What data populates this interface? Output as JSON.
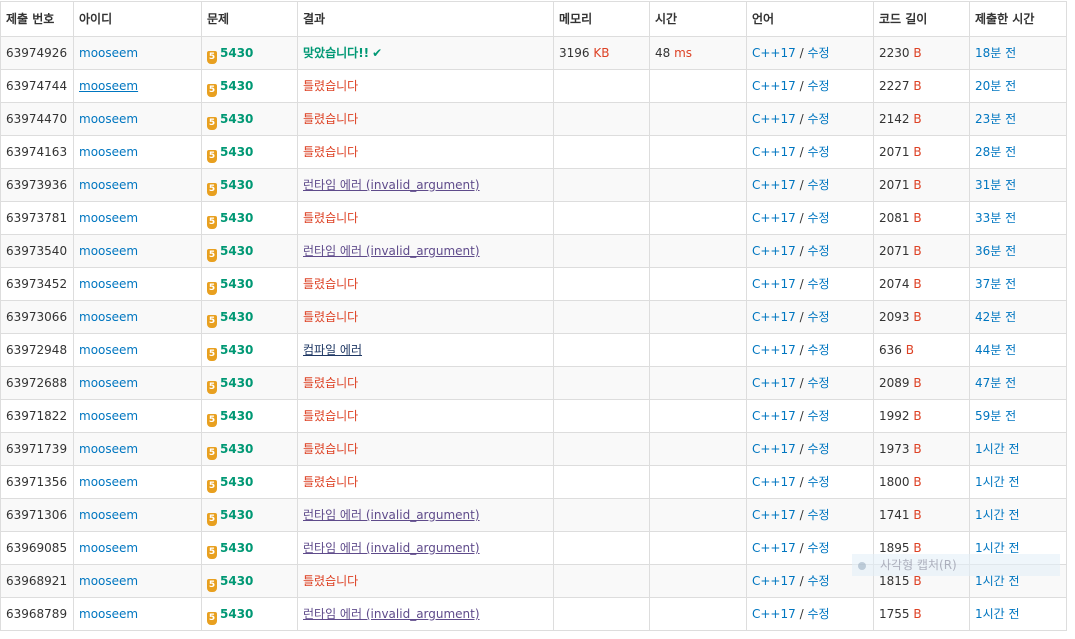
{
  "headers": [
    "제출 번호",
    "아이디",
    "문제",
    "결과",
    "메모리",
    "시간",
    "언어",
    "코드 길이",
    "제출한 시간"
  ],
  "tier_label": "5",
  "lang_sep": " / ",
  "overlay_text": "사각형 캡처(R)",
  "rows": [
    {
      "id": "63974926",
      "user": "mooseem",
      "problem": "5430",
      "result": "맞았습니다!!",
      "result_type": "ac",
      "memory": "3196",
      "memory_unit": "KB",
      "time": "48",
      "time_unit": "ms",
      "lang": "C++17",
      "edit": "수정",
      "length": "2230",
      "length_unit": "B",
      "submitted": "18분 전"
    },
    {
      "id": "63974744",
      "user": "mooseem",
      "problem": "5430",
      "result": "틀렸습니다",
      "result_type": "wa",
      "memory": "",
      "memory_unit": "",
      "time": "",
      "time_unit": "",
      "lang": "C++17",
      "edit": "수정",
      "length": "2227",
      "length_unit": "B",
      "submitted": "20분 전",
      "user_underline": true
    },
    {
      "id": "63974470",
      "user": "mooseem",
      "problem": "5430",
      "result": "틀렸습니다",
      "result_type": "wa",
      "memory": "",
      "memory_unit": "",
      "time": "",
      "time_unit": "",
      "lang": "C++17",
      "edit": "수정",
      "length": "2142",
      "length_unit": "B",
      "submitted": "23분 전"
    },
    {
      "id": "63974163",
      "user": "mooseem",
      "problem": "5430",
      "result": "틀렸습니다",
      "result_type": "wa",
      "memory": "",
      "memory_unit": "",
      "time": "",
      "time_unit": "",
      "lang": "C++17",
      "edit": "수정",
      "length": "2071",
      "length_unit": "B",
      "submitted": "28분 전"
    },
    {
      "id": "63973936",
      "user": "mooseem",
      "problem": "5430",
      "result": "런타임 에러 (invalid_argument)",
      "result_type": "re",
      "memory": "",
      "memory_unit": "",
      "time": "",
      "time_unit": "",
      "lang": "C++17",
      "edit": "수정",
      "length": "2071",
      "length_unit": "B",
      "submitted": "31분 전"
    },
    {
      "id": "63973781",
      "user": "mooseem",
      "problem": "5430",
      "result": "틀렸습니다",
      "result_type": "wa",
      "memory": "",
      "memory_unit": "",
      "time": "",
      "time_unit": "",
      "lang": "C++17",
      "edit": "수정",
      "length": "2081",
      "length_unit": "B",
      "submitted": "33분 전"
    },
    {
      "id": "63973540",
      "user": "mooseem",
      "problem": "5430",
      "result": "런타임 에러 (invalid_argument)",
      "result_type": "re",
      "memory": "",
      "memory_unit": "",
      "time": "",
      "time_unit": "",
      "lang": "C++17",
      "edit": "수정",
      "length": "2071",
      "length_unit": "B",
      "submitted": "36분 전"
    },
    {
      "id": "63973452",
      "user": "mooseem",
      "problem": "5430",
      "result": "틀렸습니다",
      "result_type": "wa",
      "memory": "",
      "memory_unit": "",
      "time": "",
      "time_unit": "",
      "lang": "C++17",
      "edit": "수정",
      "length": "2074",
      "length_unit": "B",
      "submitted": "37분 전"
    },
    {
      "id": "63973066",
      "user": "mooseem",
      "problem": "5430",
      "result": "틀렸습니다",
      "result_type": "wa",
      "memory": "",
      "memory_unit": "",
      "time": "",
      "time_unit": "",
      "lang": "C++17",
      "edit": "수정",
      "length": "2093",
      "length_unit": "B",
      "submitted": "42분 전"
    },
    {
      "id": "63972948",
      "user": "mooseem",
      "problem": "5430",
      "result": "컴파일 에러",
      "result_type": "ce",
      "memory": "",
      "memory_unit": "",
      "time": "",
      "time_unit": "",
      "lang": "C++17",
      "edit": "수정",
      "length": "636",
      "length_unit": "B",
      "submitted": "44분 전"
    },
    {
      "id": "63972688",
      "user": "mooseem",
      "problem": "5430",
      "result": "틀렸습니다",
      "result_type": "wa",
      "memory": "",
      "memory_unit": "",
      "time": "",
      "time_unit": "",
      "lang": "C++17",
      "edit": "수정",
      "length": "2089",
      "length_unit": "B",
      "submitted": "47분 전"
    },
    {
      "id": "63971822",
      "user": "mooseem",
      "problem": "5430",
      "result": "틀렸습니다",
      "result_type": "wa",
      "memory": "",
      "memory_unit": "",
      "time": "",
      "time_unit": "",
      "lang": "C++17",
      "edit": "수정",
      "length": "1992",
      "length_unit": "B",
      "submitted": "59분 전"
    },
    {
      "id": "63971739",
      "user": "mooseem",
      "problem": "5430",
      "result": "틀렸습니다",
      "result_type": "wa",
      "memory": "",
      "memory_unit": "",
      "time": "",
      "time_unit": "",
      "lang": "C++17",
      "edit": "수정",
      "length": "1973",
      "length_unit": "B",
      "submitted": "1시간 전"
    },
    {
      "id": "63971356",
      "user": "mooseem",
      "problem": "5430",
      "result": "틀렸습니다",
      "result_type": "wa",
      "memory": "",
      "memory_unit": "",
      "time": "",
      "time_unit": "",
      "lang": "C++17",
      "edit": "수정",
      "length": "1800",
      "length_unit": "B",
      "submitted": "1시간 전"
    },
    {
      "id": "63971306",
      "user": "mooseem",
      "problem": "5430",
      "result": "런타임 에러 (invalid_argument)",
      "result_type": "re",
      "memory": "",
      "memory_unit": "",
      "time": "",
      "time_unit": "",
      "lang": "C++17",
      "edit": "수정",
      "length": "1741",
      "length_unit": "B",
      "submitted": "1시간 전"
    },
    {
      "id": "63969085",
      "user": "mooseem",
      "problem": "5430",
      "result": "런타임 에러 (invalid_argument)",
      "result_type": "re",
      "memory": "",
      "memory_unit": "",
      "time": "",
      "time_unit": "",
      "lang": "C++17",
      "edit": "수정",
      "length": "1895",
      "length_unit": "B",
      "submitted": "1시간 전"
    },
    {
      "id": "63968921",
      "user": "mooseem",
      "problem": "5430",
      "result": "틀렸습니다",
      "result_type": "wa",
      "memory": "",
      "memory_unit": "",
      "time": "",
      "time_unit": "",
      "lang": "C++17",
      "edit": "수정",
      "length": "1815",
      "length_unit": "B",
      "submitted": "1시간 전"
    },
    {
      "id": "63968789",
      "user": "mooseem",
      "problem": "5430",
      "result": "런타임 에러 (invalid_argument)",
      "result_type": "re",
      "memory": "",
      "memory_unit": "",
      "time": "",
      "time_unit": "",
      "lang": "C++17",
      "edit": "수정",
      "length": "1755",
      "length_unit": "B",
      "submitted": "1시간 전"
    }
  ],
  "colors": {
    "accepted": "#009874",
    "wrong": "#dd4124",
    "runtime_error": "#5f4b8b",
    "compile_error": "#1f3864",
    "link": "#0076c0",
    "tier_badge": "#e8a020"
  }
}
